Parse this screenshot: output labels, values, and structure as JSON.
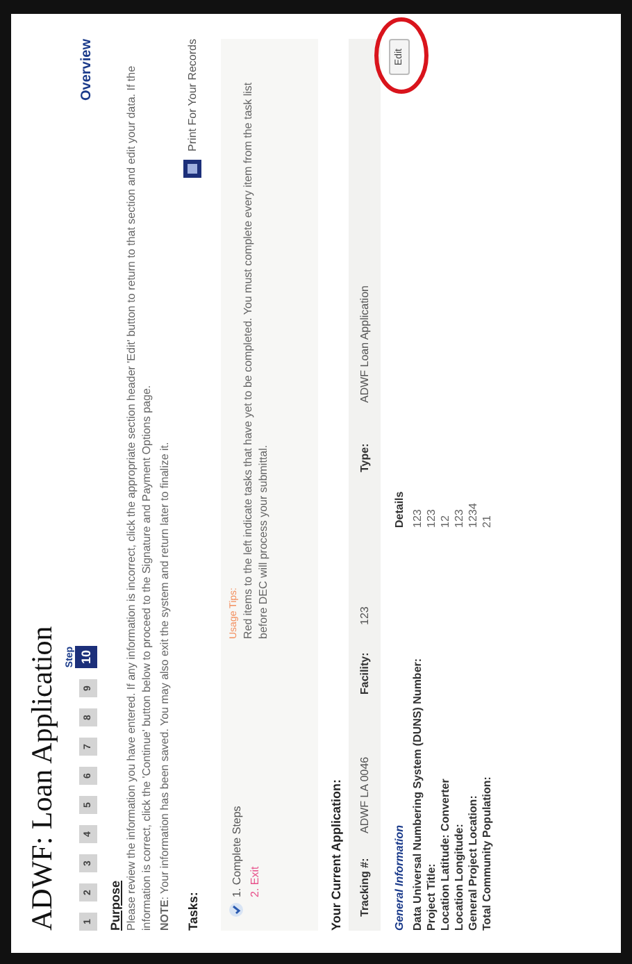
{
  "title": "ADWF: Loan Application",
  "steps": [
    {
      "label": "1",
      "selected": false
    },
    {
      "label": "2",
      "selected": false
    },
    {
      "label": "3",
      "selected": false
    },
    {
      "label": "4",
      "selected": false
    },
    {
      "label": "5",
      "selected": false
    },
    {
      "label": "6",
      "selected": false
    },
    {
      "label": "7",
      "selected": false
    },
    {
      "label": "8",
      "selected": false
    },
    {
      "label": "9",
      "selected": false
    },
    {
      "label": "10",
      "selected": true
    }
  ],
  "step_caption": "Step",
  "section_title": "Overview",
  "purpose": {
    "heading": "Purpose",
    "text": "Please review the information you have entered. If any information is incorrect, click the appropriate section header 'Edit' button to return to that section and edit your data. If the information is correct, click the 'Continue' button below to proceed to the Signature and Payment Options page.",
    "note": "**NOTE**: Your information has been saved. You may also exit the system and return later to finalize it."
  },
  "tasks": {
    "heading": "Tasks:",
    "print_link": "Print For Your Records",
    "items": [
      {
        "label": "1. Complete Steps",
        "completed": true
      },
      {
        "label": "2. Exit",
        "completed": false
      }
    ],
    "tips_heading": "Usage Tips:",
    "tips_text": "Red items to the left indicate tasks that have yet to be completed. You must complete every item from the task list before DEC will process your submittal."
  },
  "application": {
    "heading": "Your Current Application:",
    "fields": [
      {
        "label": "Tracking #:",
        "value": "ADWF LA 0046"
      },
      {
        "label": "Facility:",
        "value": "123"
      },
      {
        "label": "Type:",
        "value": "ADWF Loan Application"
      }
    ]
  },
  "general": {
    "heading": "General Information",
    "details_heading": "Details",
    "edit_button": "Edit",
    "rows": [
      {
        "label": "Data Universal Numbering System (DUNS) Number:",
        "value": "123"
      },
      {
        "label": "Project Title:",
        "value": "123"
      },
      {
        "label": "Location Latitude: Converter",
        "value": "12"
      },
      {
        "label": "Location Longitude:",
        "value": "123"
      },
      {
        "label": "General Project Location:",
        "value": "1234"
      },
      {
        "label": "Total Community Population:",
        "value": "21"
      }
    ]
  }
}
